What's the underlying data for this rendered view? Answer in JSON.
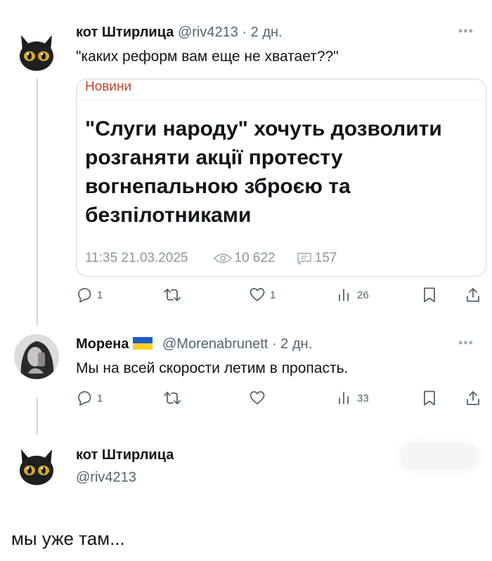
{
  "tweet1": {
    "display_name": "кот Штирлица",
    "handle": "@riv4213",
    "separator": "·",
    "time": "2 дн.",
    "text": "\"каких реформ вам еще не хватает??\"",
    "card": {
      "tag": "Новини",
      "headline": "\"Слуги народу\" хочуть дозволити розганяти акції протесту вогнепальною зброєю та безпілотниками",
      "timestamp": "11:35 21.03.2025",
      "views": "10 622",
      "comments": "157"
    },
    "actions": {
      "reply_count": "1",
      "retweet_count": "",
      "like_count": "1",
      "view_count": "26"
    }
  },
  "tweet2": {
    "display_name": "Морена",
    "handle": "@Morenabrunett",
    "separator": "·",
    "time": "2 дн.",
    "text": "Мы на всей скорости летим в пропасть.",
    "actions": {
      "reply_count": "1",
      "retweet_count": "",
      "like_count": "",
      "view_count": "33"
    }
  },
  "tweet3": {
    "display_name": "кот Штирлица",
    "handle": "@riv4213",
    "text": "мы уже там..."
  },
  "colors": {
    "text_primary": "#0f1419",
    "text_secondary": "#536471",
    "tag_color": "#c0452d",
    "border": "#cfd9de",
    "flag_blue": "#1e5bc6",
    "flag_yellow": "#f7cf2b"
  },
  "icons": [
    "more-icon",
    "reply-icon",
    "retweet-icon",
    "like-icon",
    "views-icon",
    "bookmark-icon",
    "share-icon",
    "eye-icon",
    "comment-icon",
    "ukraine-flag-icon"
  ]
}
